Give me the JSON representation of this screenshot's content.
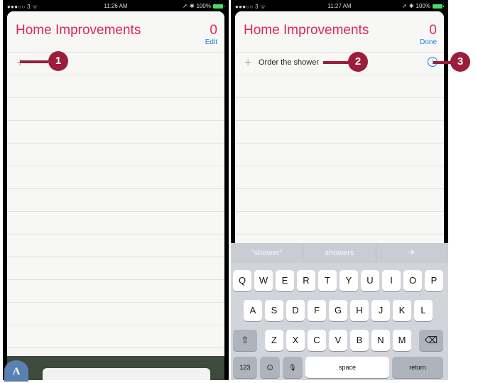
{
  "left_screen": {
    "status": {
      "carrier": "●●●○○ 3 ᯤ",
      "time": "11:26 AM",
      "battery": "100%"
    },
    "list_title": "Home Improvements",
    "count": "0",
    "action": "Edit"
  },
  "right_screen": {
    "status": {
      "carrier": "●●●○○ 3 ᯤ",
      "time": "11:27 AM",
      "battery": "100%"
    },
    "list_title": "Home Improvements",
    "count": "0",
    "action": "Done",
    "item_text": "Order the shower",
    "info_glyph": "i",
    "suggestions": [
      "\"shower\"",
      "showers",
      "✈"
    ],
    "keyboard": {
      "row1": [
        "Q",
        "W",
        "E",
        "R",
        "T",
        "Y",
        "U",
        "I",
        "O",
        "P"
      ],
      "row2": [
        "A",
        "S",
        "D",
        "F",
        "G",
        "H",
        "J",
        "K",
        "L"
      ],
      "row3": [
        "Z",
        "X",
        "C",
        "V",
        "B",
        "N",
        "M"
      ],
      "shift": "⇧",
      "delete": "⌫",
      "numbers": "123",
      "emoji": "☺",
      "mic": "🎙",
      "space": "space",
      "return": "return"
    }
  },
  "callouts": [
    "1",
    "2",
    "3",
    "A"
  ],
  "colors": {
    "title_red": "#e0245e",
    "link_blue": "#1e7cf2",
    "callout": "#9c1d3a",
    "badge": "#5a7fb2"
  }
}
